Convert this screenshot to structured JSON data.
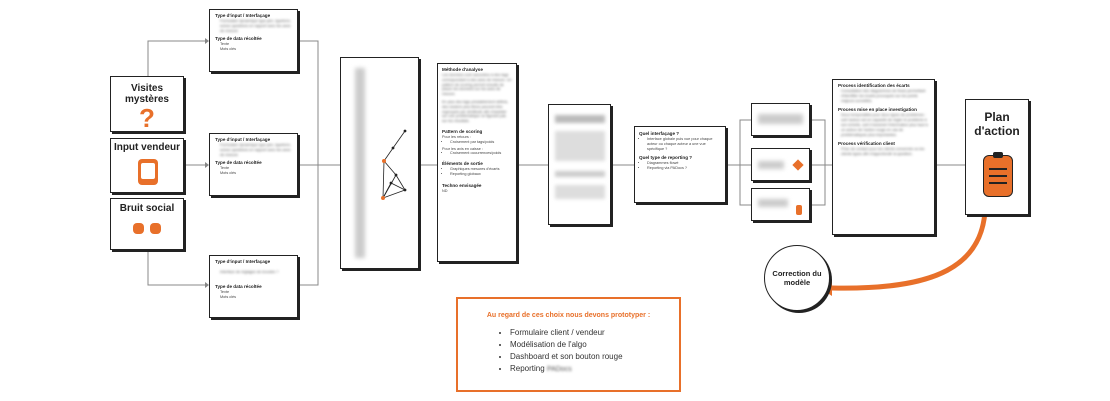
{
  "sources": [
    {
      "label": "Visites mystères",
      "icon": "question-mark-icon"
    },
    {
      "label": "Input vendeur",
      "icon": "tablet-icon"
    },
    {
      "label": "Bruit social",
      "icon": "social-icons"
    }
  ],
  "interfaces": [
    {
      "h1": "Type d'input / Interfaçage",
      "t1": "Formulaire dynamique type jam, typeform, suivez questions en rapport avec les axes de mesure",
      "h2": "Type de data récoltée",
      "t2a": "Texte",
      "t2b": "Mots clés"
    },
    {
      "h1": "Type d'input / Interfaçage",
      "t1": "Formulaire dynamique type jam, typeform, suivez questions en rapport avec les axes de mesure",
      "h2": "Type de data récoltée",
      "t2a": "Texte",
      "t2b": "Mots clés"
    },
    {
      "h1": "Type d'input / Interfaçage",
      "t1": "Interface de réglages de écoutes ?",
      "h2": "Type de data récoltée",
      "t2a": "Texte",
      "t2b": "Mots clés"
    }
  ],
  "analysis": {
    "h1": "Méthode d'analyse",
    "t1": "Les données sont associées à des tags correspondant à des axes de mesure. Un pattern de scoring permet ensuite de placer les données sur les axes de mesure.",
    "t1b": "En plus des tags préalablement définis, des clusters plus libres peuvent être regroupés par similitude afin d'assister sur une problématique ne figurant pas sur les résultats.",
    "h2": "Pattern de scoring",
    "t2": "Pour les retours :",
    "l2a": "Croisement par tags/poids",
    "t2b": "Pour les avis en caisse :",
    "l2b": "Croisement occurrences/poids",
    "h3": "Éléments de sortie",
    "l3a": "Graphiques mesures d'écarts",
    "l3b": "Reporting globaux",
    "h4": "Techno envisagée",
    "t4": "ND"
  },
  "interface_box": {
    "h1": "Quel interfaçage ?",
    "l1": "Interface globale puis vue pour chaque acteur ou chaque acteur a une vue spécifique ?",
    "h2": "Quel type de reporting ?",
    "l2a": "Diagrammes flowé",
    "l2b": "Reporting via PADocs ?"
  },
  "processes": {
    "h1": "Process identification des écarts",
    "t1": "Consultation des diagrammes de flows permettant d'identifier les écarts provoqués sur les points majeurs surveillés.",
    "h2": "Process mise en place investigation",
    "t2": "Deux temporalités pour deux types de problèmes : soit l'acteur est en capacité de régler le problème à son échelle, soit il transmet l'information plus haut à un acteur de l'action rouge en cas de problématiques plus importantes.",
    "h3": "Process vérification client",
    "t3": "Prise de contact pour les clients concernés ou les clients types afin d'approfondir la question."
  },
  "plan": {
    "label1": "Plan",
    "label2": "d'action"
  },
  "correction": {
    "label1": "Correction du",
    "label2": "modèle"
  },
  "callout": {
    "title": "Au regard de ces choix nous devons prototyper :",
    "items": [
      "Formulaire client / vendeur",
      "Modélisation de l'algo",
      "Dashboard et son bouton rouge",
      "Reporting"
    ],
    "blurred_suffix": "PADocs"
  },
  "colors": {
    "accent": "#e8702a",
    "ink": "#222222"
  }
}
